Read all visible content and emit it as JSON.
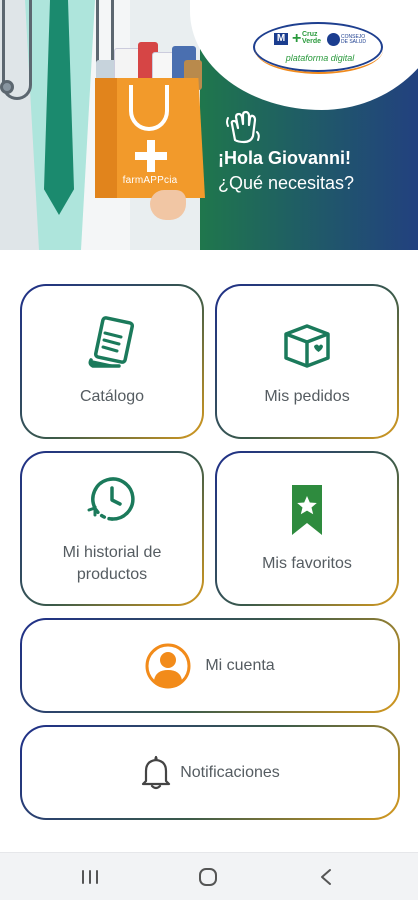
{
  "hero": {
    "greeting": "¡Hola Giovanni!",
    "question": "¿Qué necesitas?",
    "bag_label": "farmAPPcia",
    "logo_text": "plataforma digital",
    "logo_cruz": "Cruz Verde"
  },
  "tiles": {
    "catalogo": "Catálogo",
    "pedidos": "Mis pedidos",
    "historial": "Mi historial de productos",
    "favoritos": "Mis favoritos",
    "cuenta": "Mi cuenta",
    "notificaciones": "Notificaciones"
  },
  "colors": {
    "accent_green": "#1b7a5b",
    "accent_orange": "#f29a2b",
    "border_blue": "#1f2f8a",
    "border_gold": "#d69a1f"
  },
  "icons": {
    "catalogo": "document-list-icon",
    "pedidos": "package-box-icon",
    "historial": "clock-history-icon",
    "favoritos": "bookmark-star-icon",
    "cuenta": "user-avatar-icon",
    "notificaciones": "bell-icon"
  },
  "navbar": [
    "recents",
    "home",
    "back"
  ]
}
